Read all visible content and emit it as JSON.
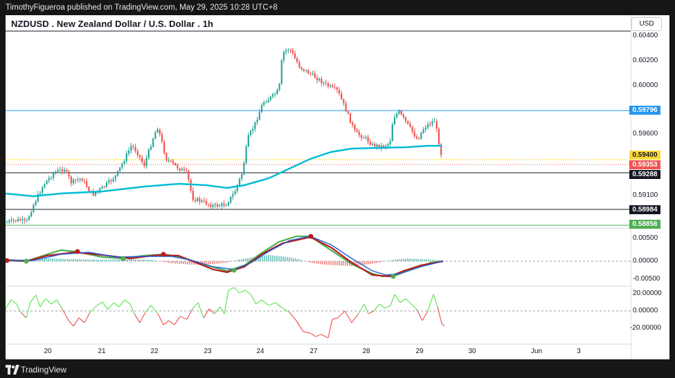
{
  "header": {
    "attribution": "TimothyFigueroa published on TradingView.com, May 29, 2025 10:28 UTC+8"
  },
  "chart": {
    "title": "NZDUSD . New Zealand Dollar / U.S. Dollar . 1h",
    "currency_button": "USD"
  },
  "price_axis": {
    "labels": [
      "0.60400",
      "0.60200",
      "0.60000",
      "0.59600",
      "0.59100"
    ]
  },
  "price_tags": {
    "blue_line": "0.59796",
    "yellow_line": "0.59400",
    "last_price": "0.59353",
    "black_line": "0.59288",
    "support_line": "0.58984",
    "green_line": "0.58856"
  },
  "oscillator1_axis": {
    "labels": [
      "0.00500",
      "0.00000",
      "-0.00500"
    ]
  },
  "oscillator2_axis": {
    "labels": [
      "20.00000",
      "0.00000",
      "-20.00000"
    ]
  },
  "time_axis": {
    "labels": [
      "20",
      "21",
      "22",
      "23",
      "24",
      "27",
      "28",
      "29",
      "30",
      "Jun",
      "3"
    ]
  },
  "footer": {
    "brand": "TradingView"
  },
  "colors": {
    "up": "#26a69a",
    "down": "#ef5350",
    "ma": "#00bcd4",
    "blue_line": "#2196f3",
    "yellow_line": "#fdd835",
    "green_line": "#4caf50"
  }
}
